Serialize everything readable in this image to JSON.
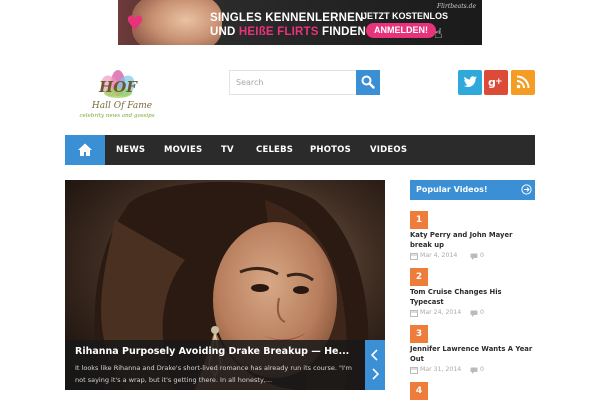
{
  "ad": {
    "line1": "SINGLES KENNENLERNEN",
    "line2_pre": "UND ",
    "line2_hot": "HEIßE FLIRTS",
    "line2_post": " FINDEN",
    "cta_top": "JETZT KOSTENLOS",
    "cta": "ANMELDEN!",
    "brand": "Flirtbeats.de"
  },
  "logo": {
    "letters": "HOF",
    "title": "Hall Of Fame",
    "tagline": "celebrity news and gossips"
  },
  "search": {
    "placeholder": "Search"
  },
  "social": [
    "twitter-icon",
    "google-plus-icon",
    "rss-icon"
  ],
  "nav": {
    "home_icon": "home-icon",
    "items": [
      "NEWS",
      "MOVIES",
      "TV",
      "CELEBS",
      "PHOTOS",
      "VIDEOS"
    ]
  },
  "featured": {
    "title": "Rihanna Purposely Avoiding Drake Breakup — He...",
    "excerpt": "It looks like Rihanna and Drake's short-lived romance has already run its course. \"I'm not saying it's a wrap, but it's getting there. In all honesty,..."
  },
  "popular": {
    "title": "Popular Videos!",
    "items": [
      {
        "rank": "1",
        "title": "Katy Perry and John Mayer break up",
        "date": "Mar 4, 2014",
        "comments": "0"
      },
      {
        "rank": "2",
        "title": "Tom Cruise Changes His Typecast",
        "date": "Mar 24, 2014",
        "comments": "0"
      },
      {
        "rank": "3",
        "title": "Jennifer Lawrence Wants A Year Out",
        "date": "Mar 31, 2014",
        "comments": "0"
      },
      {
        "rank": "4"
      }
    ]
  },
  "colors": {
    "accent": "#3a8fd5",
    "nav_bg": "#2b2b2b",
    "rank": "#ee7c3a",
    "ad_pink": "#e8327b"
  }
}
